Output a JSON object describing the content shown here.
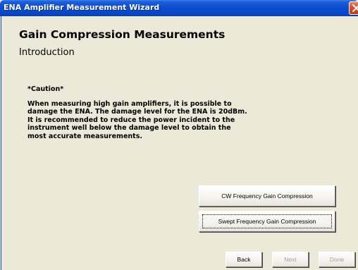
{
  "window": {
    "title": "ENA Amplifier Measurement Wizard"
  },
  "page": {
    "heading": "Gain Compression Measurements",
    "subheading": "Introduction"
  },
  "caution": {
    "title": "*Caution*",
    "lines": [
      "When measuring high gain amplifiers, it is possible to",
      "damage the ENA. The damage level for the ENA is 20dBm.",
      "It is recommended to reduce the power incident to the",
      "instrument well below the damage level to obtain the",
      "most accurate measurements."
    ]
  },
  "actions": {
    "cw_label": "CW Frequency Gain Compression",
    "swept_label": "Swept Frequency Gain Compression"
  },
  "nav": {
    "back_label": "Back",
    "next_label": "Next",
    "done_label": "Done"
  },
  "icons": {
    "close": "close-icon"
  },
  "colors": {
    "titlebar": "#0a4cd0",
    "background": "#ece9d8",
    "close": "#d64a26",
    "disabled_text": "#a0a0a0"
  }
}
